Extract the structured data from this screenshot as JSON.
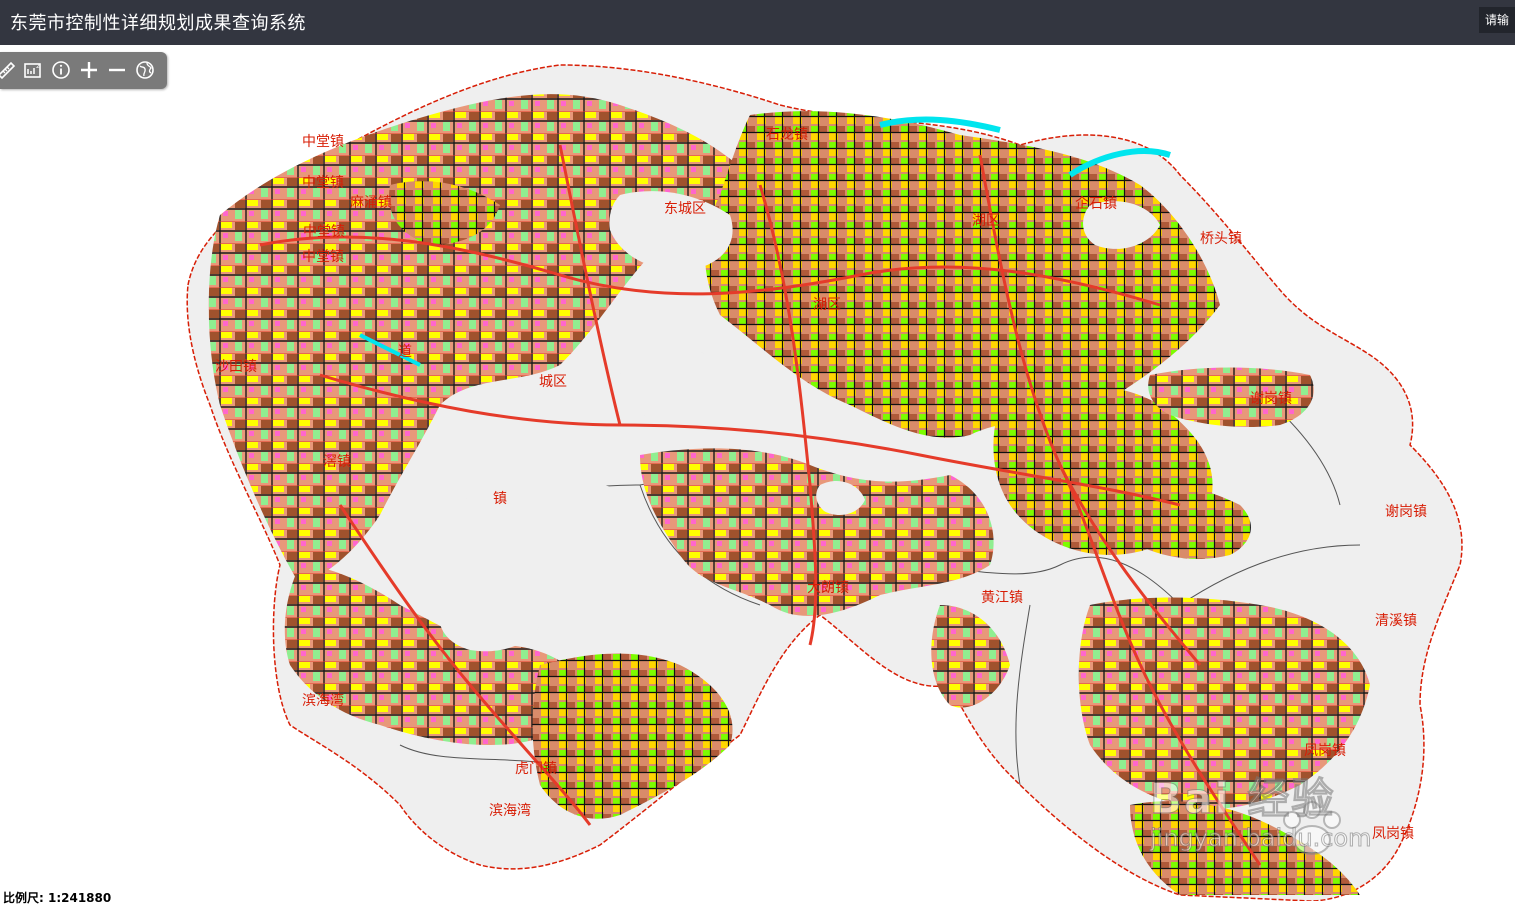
{
  "header": {
    "title": "东莞市控制性详细规划成果查询系统",
    "login_label": "请输"
  },
  "toolbar": {
    "tools": [
      {
        "name": "measure-distance",
        "icon": "ruler-icon"
      },
      {
        "name": "measure-area",
        "icon": "area-measure-icon"
      },
      {
        "name": "identify",
        "icon": "info-icon"
      },
      {
        "name": "zoom-in",
        "icon": "plus-icon"
      },
      {
        "name": "zoom-out",
        "icon": "minus-icon"
      },
      {
        "name": "full-extent",
        "icon": "globe-icon"
      }
    ]
  },
  "map": {
    "place_labels": [
      "中堂镇",
      "中堂镇",
      "中堂镇",
      "中堂镇",
      "麻涌镇",
      "石龙镇",
      "东城区",
      "企石镇",
      "桥头镇",
      "湖区",
      "道",
      "城区",
      "沙田镇",
      "滘镇",
      "虎门镇",
      "滨海湾",
      "滨海湾",
      "大朗镇",
      "谢岗镇",
      "清溪镇",
      "凤岗镇",
      "凤岗镇",
      "黄江镇",
      "镇",
      "湖区",
      "谢岗镇"
    ],
    "colors": {
      "base_fill": "#efefef",
      "outline": "#d81e06",
      "road": "#e53b2a",
      "label": "#d81e06"
    }
  },
  "status": {
    "scale_text": "比例尺: 1:241880"
  },
  "watermark": {
    "text": "Bai 经验",
    "url_text": "jingyan.baidu.com"
  }
}
